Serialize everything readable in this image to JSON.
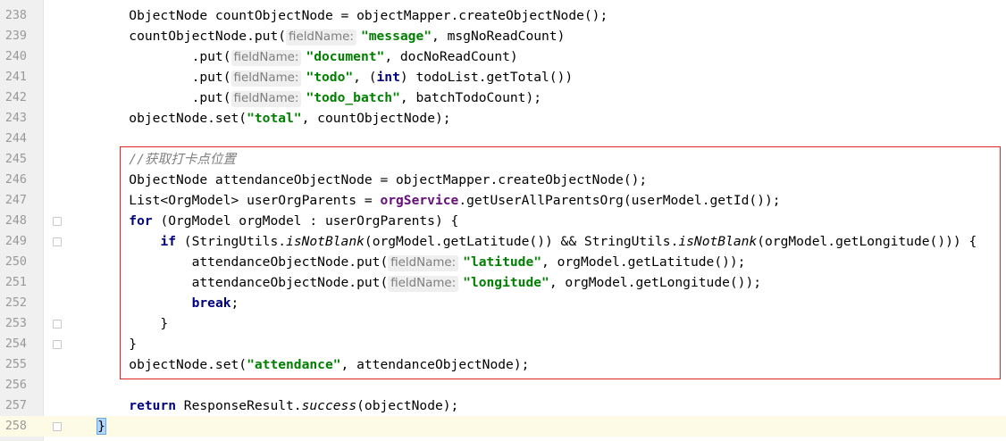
{
  "editor": {
    "lines": [
      {
        "no": "238",
        "tokens": [
          {
            "t": "        ObjectNode countObjectNode = objectMapper.createObjectNode();"
          }
        ]
      },
      {
        "no": "239",
        "tokens": [
          {
            "t": "        countObjectNode.put("
          },
          {
            "c": "hint",
            "t": "fieldName:"
          },
          {
            "c": "str",
            "t": "\"message\""
          },
          {
            "t": ", msgNoReadCount)"
          }
        ]
      },
      {
        "no": "240",
        "tokens": [
          {
            "t": "                .put("
          },
          {
            "c": "hint",
            "t": "fieldName:"
          },
          {
            "c": "str",
            "t": "\"document\""
          },
          {
            "t": ", docNoReadCount)"
          }
        ]
      },
      {
        "no": "241",
        "tokens": [
          {
            "t": "                .put("
          },
          {
            "c": "hint",
            "t": "fieldName:"
          },
          {
            "c": "str",
            "t": "\"todo\""
          },
          {
            "t": ", ("
          },
          {
            "c": "kw",
            "t": "int"
          },
          {
            "t": ") todoList.getTotal())"
          }
        ]
      },
      {
        "no": "242",
        "tokens": [
          {
            "t": "                .put("
          },
          {
            "c": "hint",
            "t": "fieldName:"
          },
          {
            "c": "str",
            "t": "\"todo_batch\""
          },
          {
            "t": ", batchTodoCount);"
          }
        ]
      },
      {
        "no": "243",
        "tokens": [
          {
            "t": "        objectNode.set("
          },
          {
            "c": "str",
            "t": "\"total\""
          },
          {
            "t": ", countObjectNode);"
          }
        ]
      },
      {
        "no": "244",
        "tokens": []
      },
      {
        "no": "245",
        "tokens": [
          {
            "t": "        "
          },
          {
            "c": "cmt",
            "t": "//获取打卡点位置"
          }
        ]
      },
      {
        "no": "246",
        "tokens": [
          {
            "t": "        ObjectNode attendanceObjectNode = objectMapper.createObjectNode();"
          }
        ]
      },
      {
        "no": "247",
        "tokens": [
          {
            "t": "        List<OrgModel> userOrgParents = "
          },
          {
            "c": "fld",
            "t": "orgService"
          },
          {
            "t": ".getUserAllParentsOrg(userModel.getId());"
          }
        ]
      },
      {
        "no": "248",
        "fold": true,
        "tokens": [
          {
            "t": "        "
          },
          {
            "c": "kw",
            "t": "for"
          },
          {
            "t": " (OrgModel orgModel : userOrgParents) {"
          }
        ]
      },
      {
        "no": "249",
        "fold": true,
        "tokens": [
          {
            "t": "            "
          },
          {
            "c": "kw",
            "t": "if"
          },
          {
            "t": " (StringUtils."
          },
          {
            "c": "it",
            "t": "isNotBlank"
          },
          {
            "t": "(orgModel.getLatitude()) && StringUtils."
          },
          {
            "c": "it",
            "t": "isNotBlank"
          },
          {
            "t": "(orgModel.getLongitude())) {"
          }
        ]
      },
      {
        "no": "250",
        "tokens": [
          {
            "t": "                attendanceObjectNode.put("
          },
          {
            "c": "hint",
            "t": "fieldName:"
          },
          {
            "c": "str",
            "t": "\"latitude\""
          },
          {
            "t": ", orgModel.getLatitude());"
          }
        ]
      },
      {
        "no": "251",
        "tokens": [
          {
            "t": "                attendanceObjectNode.put("
          },
          {
            "c": "hint",
            "t": "fieldName:"
          },
          {
            "c": "str",
            "t": "\"longitude\""
          },
          {
            "t": ", orgModel.getLongitude());"
          }
        ]
      },
      {
        "no": "252",
        "tokens": [
          {
            "t": "                "
          },
          {
            "c": "kw",
            "t": "break"
          },
          {
            "t": ";"
          }
        ]
      },
      {
        "no": "253",
        "fold": true,
        "tokens": [
          {
            "t": "            }"
          }
        ]
      },
      {
        "no": "254",
        "fold": true,
        "tokens": [
          {
            "t": "        }"
          }
        ]
      },
      {
        "no": "255",
        "tokens": [
          {
            "t": "        objectNode.set("
          },
          {
            "c": "str",
            "t": "\"attendance\""
          },
          {
            "t": ", attendanceObjectNode);"
          }
        ]
      },
      {
        "no": "256",
        "tokens": []
      },
      {
        "no": "257",
        "tokens": [
          {
            "t": "        "
          },
          {
            "c": "kw",
            "t": "return"
          },
          {
            "t": " ResponseResult."
          },
          {
            "c": "it",
            "t": "success"
          },
          {
            "t": "(objectNode);"
          }
        ]
      },
      {
        "no": "258",
        "fold": true,
        "caret": true,
        "tokens": [
          {
            "t": "    "
          },
          {
            "c": "brace-hl",
            "t": "}"
          }
        ]
      }
    ]
  },
  "colors": {
    "keyword": "#000080",
    "string": "#008000",
    "field": "#660e7a",
    "comment": "#808080",
    "highlight_box": "#e02424",
    "caret_line": "#fdfbe6"
  }
}
